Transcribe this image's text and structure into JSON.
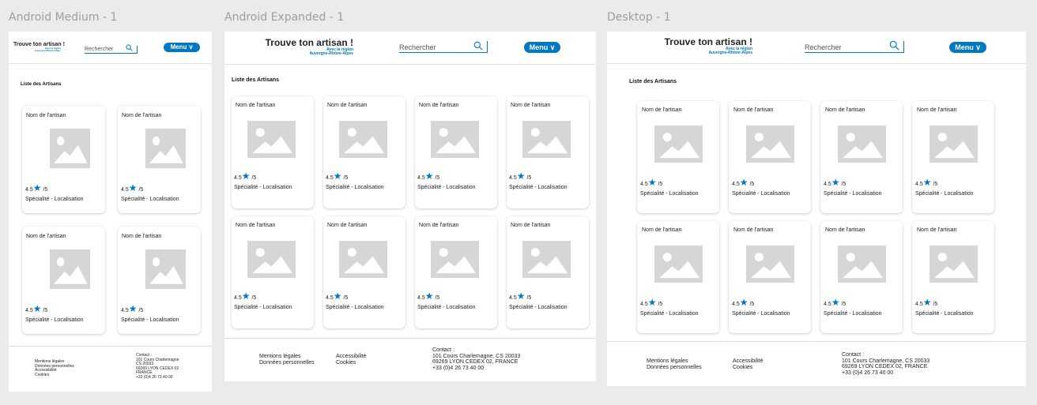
{
  "frames": [
    {
      "title": "Android Medium - 1"
    },
    {
      "title": "Android Expanded - 1"
    },
    {
      "title": "Desktop - 1"
    }
  ],
  "header": {
    "logo_title": "Trouve ton artisan !",
    "logo_subtitle_1": "Avec la région",
    "logo_subtitle_2": "Auvergne-Rhône-Alpes",
    "search_placeholder": "Rechercher",
    "menu_label": "Menu ∨"
  },
  "list_title": "Liste des Artisans",
  "card": {
    "name": "Nom de l'artisan",
    "rating_value": "4.5",
    "rating_suffix": "/5",
    "specialty": "Spécialité - Localisation"
  },
  "footer": {
    "links_col1": [
      "Mentions légales",
      "Données personnelles"
    ],
    "links_col2": [
      "Accessibilité",
      "Cookies"
    ],
    "medium_links": [
      "Mentions légales",
      "Données personnelles",
      "Accessibilité",
      "Cookies"
    ],
    "contact_heading": "Contact :",
    "contact_lines": [
      "101 Cours Charlemagne, CS 20033",
      "69269 LYON CEDEX 02, FRANCE",
      "+33 (0)4 26 73 40 00"
    ],
    "medium_contact_lines": [
      "101 Cours Charlemagne",
      "CS 20033",
      "69269 LYON CEDEX 02",
      "FRANCE",
      "+33 (0)4 26 73 40 00"
    ]
  },
  "colors": {
    "accent": "#0079c2",
    "placeholder_image": "#d6d6d6"
  },
  "icons": {
    "search": "magnifier-icon",
    "rating": "star-icon",
    "image": "image-placeholder-icon"
  }
}
